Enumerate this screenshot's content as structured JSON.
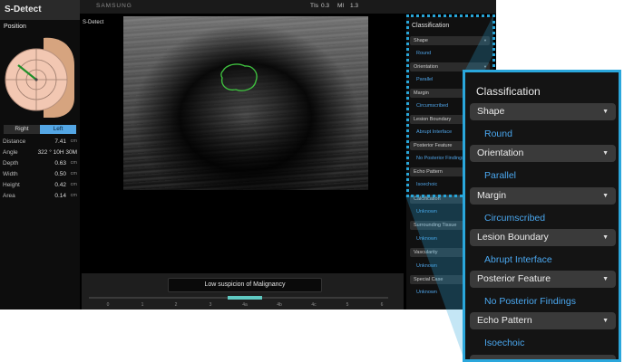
{
  "app": {
    "title": "S-Detect",
    "brand": "SAMSUNG",
    "image_label": "S-Detect"
  },
  "position": {
    "label": "Position",
    "buttons": {
      "right": "Right",
      "left": "Left",
      "selected": "Left"
    }
  },
  "measurements": [
    {
      "label": "Distance",
      "value": "7.41",
      "unit": "cm"
    },
    {
      "label": "Angle",
      "value": "322 ° 10H 30M",
      "unit": ""
    },
    {
      "label": "Depth",
      "value": "0.63",
      "unit": "cm"
    },
    {
      "label": "Width",
      "value": "0.50",
      "unit": "cm"
    },
    {
      "label": "Height",
      "value": "0.42",
      "unit": "cm"
    },
    {
      "label": "Area",
      "value": "0.14",
      "unit": "cm"
    }
  ],
  "indices": {
    "tis_label": "TIs",
    "tis_value": "0.3",
    "mi_label": "MI",
    "mi_value": "1.3"
  },
  "result": {
    "text": "Low suspicion of Malignancy",
    "scale_ticks": [
      "0",
      "1",
      "2",
      "3",
      "4a",
      "4b",
      "4c",
      "5",
      "6"
    ],
    "highlight": "4a"
  },
  "classification_small": {
    "title": "Classification",
    "items": [
      {
        "label": "Shape",
        "value": "Round"
      },
      {
        "label": "Orientation",
        "value": "Parallel"
      },
      {
        "label": "Margin",
        "value": "Circumscribed"
      },
      {
        "label": "Lesion Boundary",
        "value": "Abrupt Interface"
      },
      {
        "label": "Posterior Feature",
        "value": "No Posterior Findings"
      },
      {
        "label": "Echo Pattern",
        "value": "Isoechoic"
      },
      {
        "label": "Calcification",
        "value": "Unknown"
      },
      {
        "label": "Surrounding Tissue",
        "value": "Unknown"
      },
      {
        "label": "Vascularity",
        "value": "Unknown"
      },
      {
        "label": "Special Case",
        "value": "Unknown"
      }
    ]
  },
  "classification_zoom": {
    "title": "Classification",
    "items": [
      {
        "label": "Shape",
        "value": "Round"
      },
      {
        "label": "Orientation",
        "value": "Parallel"
      },
      {
        "label": "Margin",
        "value": "Circumscribed"
      },
      {
        "label": "Lesion Boundary",
        "value": "Abrupt Interface"
      },
      {
        "label": "Posterior Feature",
        "value": "No Posterior Findings"
      },
      {
        "label": "Echo Pattern",
        "value": "Isoechoic"
      }
    ]
  },
  "colors": {
    "accent_blue": "#2aa7dc",
    "value_text": "#4aa7ef",
    "lesion_outline": "#3fbf3f",
    "scale_highlight": "#5fc9c2",
    "selected_button": "#54a6e4"
  }
}
